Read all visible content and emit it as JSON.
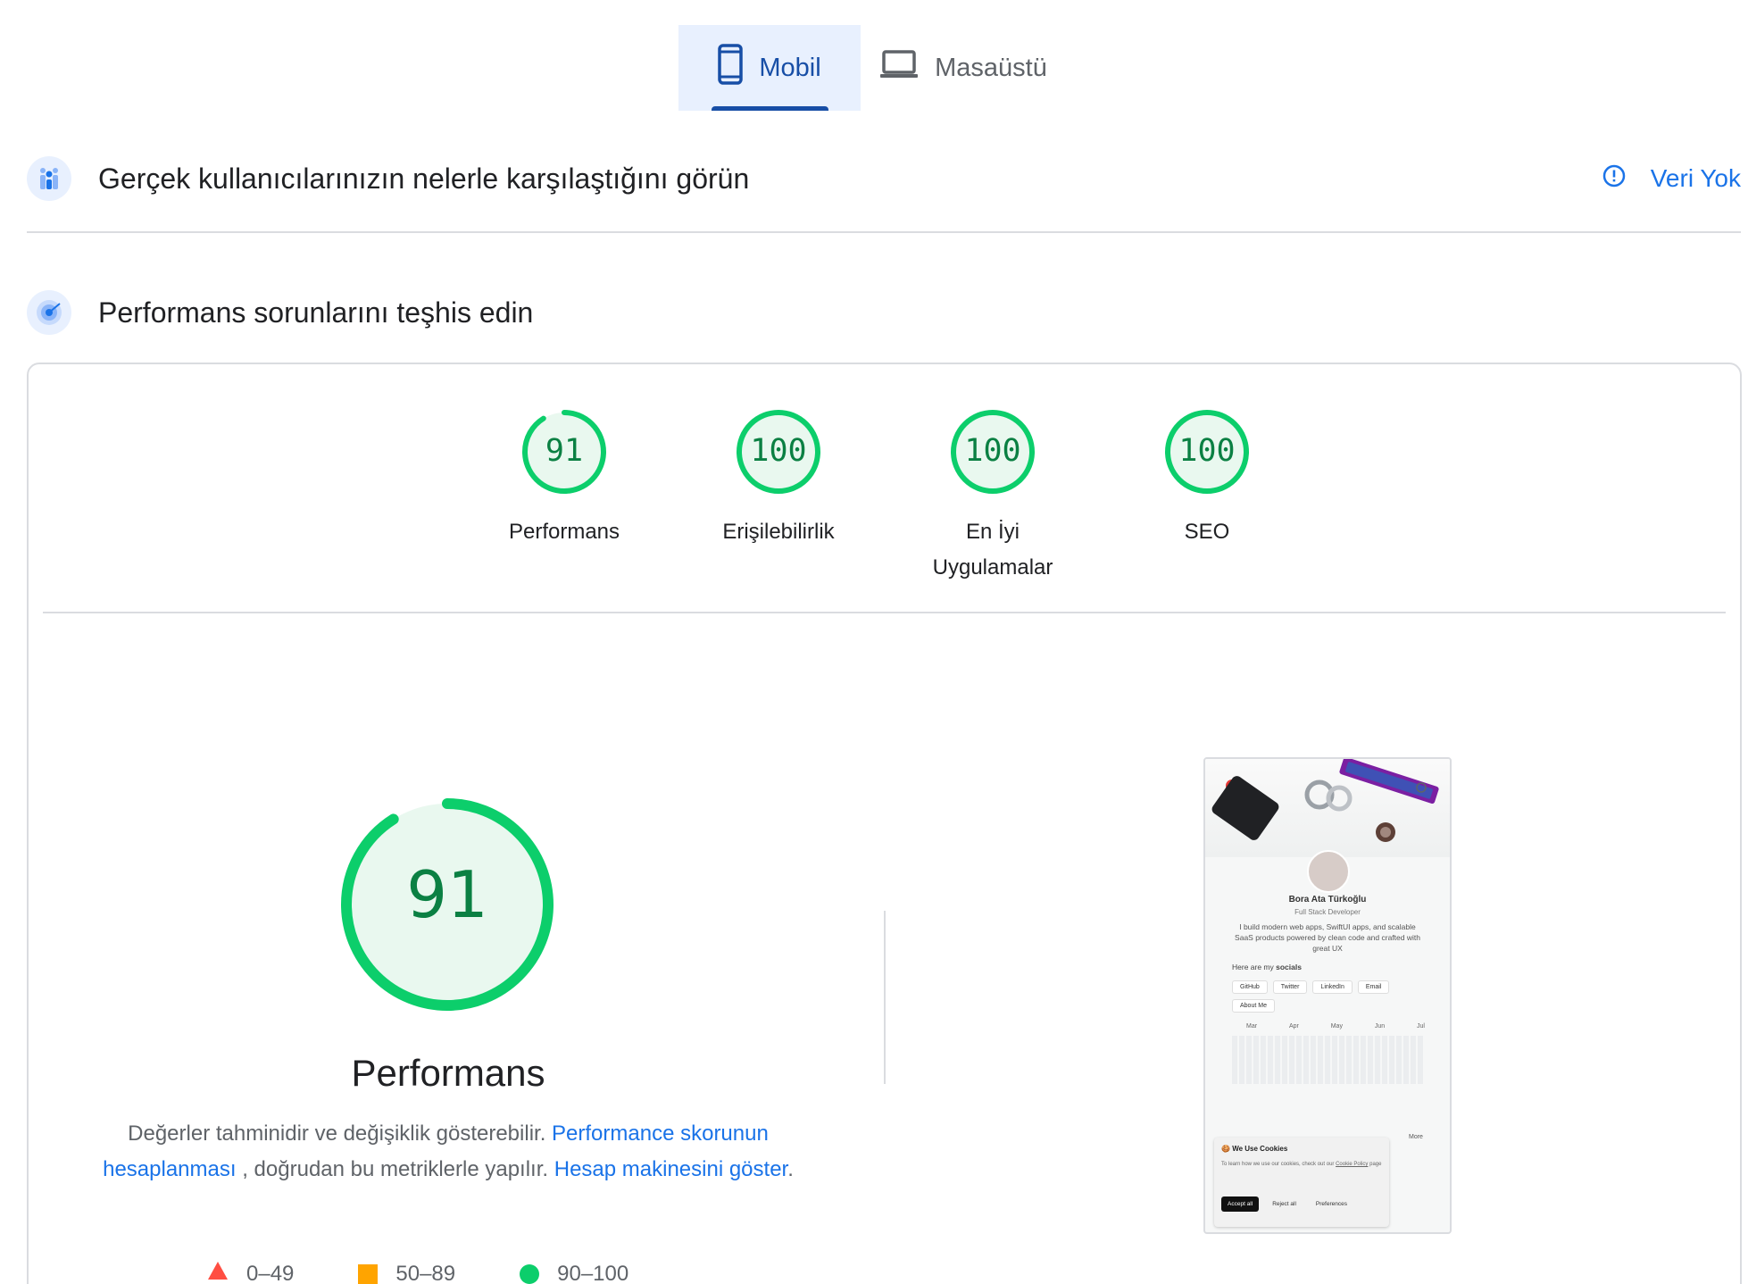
{
  "tabs": [
    {
      "label": "Mobil",
      "icon": "smartphone-icon",
      "active": true
    },
    {
      "label": "Masaüstü",
      "icon": "laptop-icon",
      "active": false
    }
  ],
  "field_data": {
    "title": "Gerçek kullanıcılarınızın nelerle karşılaştığını görün",
    "status": "Veri Yok",
    "status_icon": "info-icon"
  },
  "diagnose": {
    "title": "Performans sorunlarını teşhis edin"
  },
  "scores": [
    {
      "value": "91",
      "label": "Performans"
    },
    {
      "value": "100",
      "label": "Erişilebilirlik"
    },
    {
      "value": "100",
      "label": "En İyi Uygulamalar"
    },
    {
      "value": "100",
      "label": "SEO"
    }
  ],
  "performance": {
    "score": "91",
    "score_fraction": 0.91,
    "title": "Performans",
    "desc_text_1": "Değerler tahminidir ve değişiklik gösterebilir.",
    "desc_link_1": "Performance skorunun hesaplanması",
    "desc_text_2": ", doğrudan bu metriklerle yapılır.",
    "desc_link_2": "Hesap makinesini göster",
    "desc_text_3": "."
  },
  "legend": [
    {
      "label": "0–49",
      "shape": "triangle",
      "color": "#ff4e42"
    },
    {
      "label": "50–89",
      "shape": "square",
      "color": "#ffa400"
    },
    {
      "label": "90–100",
      "shape": "circle",
      "color": "#0cce6b"
    }
  ],
  "colors": {
    "good": "#0cce6b",
    "good_text": "#0b8043",
    "good_bg": "#e9f8ef",
    "link": "#1a73e8",
    "tab_active_bg": "#e8f0fe",
    "tab_active_fg": "#174ea6"
  },
  "screenshot": {
    "name": "Bora Ata Türkoğlu",
    "role": "Full Stack Developer",
    "bio": "I build modern web apps, SwiftUI apps, and scalable SaaS products powered by clean code and crafted with great UX",
    "socials_prefix": "Here are my",
    "socials_bold": "socials",
    "buttons": [
      "GitHub",
      "Twitter",
      "LinkedIn",
      "Email",
      "About Me"
    ],
    "months": [
      "Mar",
      "Apr",
      "May",
      "Jun",
      "Jul"
    ],
    "more": "More",
    "cookie_title": "We Use Cookies",
    "cookie_text": "To learn how we use our cookies, check out our",
    "cookie_link": "Cookie Policy",
    "cookie_page": "page",
    "cookie_buttons": [
      "Accept all",
      "Reject all",
      "Preferences"
    ]
  }
}
